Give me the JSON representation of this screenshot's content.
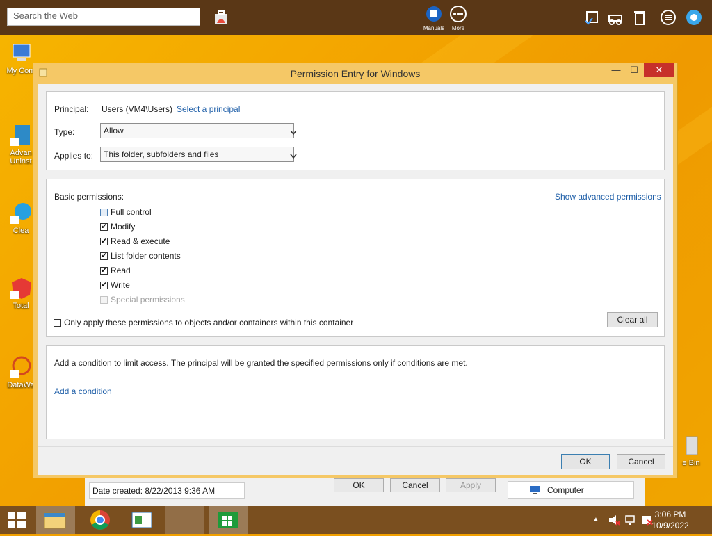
{
  "topbar": {
    "search_placeholder": "Search the Web",
    "manuals_label": "Manuals",
    "more_label": "More"
  },
  "desktop_icons": [
    {
      "label": "My Com"
    },
    {
      "label": "Advan Uninst"
    },
    {
      "label": "Clea"
    },
    {
      "label": "Total"
    },
    {
      "label": "DataWa"
    },
    {
      "label": "e Bin"
    }
  ],
  "dialog": {
    "title": "Permission Entry for Windows",
    "principal_label": "Principal:",
    "principal_value": "Users (VM4\\Users)",
    "select_principal_link": "Select a principal",
    "type_label": "Type:",
    "type_value": "Allow",
    "applies_label": "Applies to:",
    "applies_value": "This folder, subfolders and files",
    "basic_permissions_label": "Basic permissions:",
    "show_advanced_link": "Show advanced permissions",
    "permissions": [
      {
        "label": "Full control",
        "checked": false
      },
      {
        "label": "Modify",
        "checked": true
      },
      {
        "label": "Read & execute",
        "checked": true
      },
      {
        "label": "List folder contents",
        "checked": true
      },
      {
        "label": "Read",
        "checked": true
      },
      {
        "label": "Write",
        "checked": true
      },
      {
        "label": "Special permissions",
        "checked": false,
        "disabled": true
      }
    ],
    "only_apply_label": "Only apply these permissions to objects and/or containers within this container",
    "clear_all_label": "Clear all",
    "condition_text": "Add a condition to limit access. The principal will be granted the specified permissions only if conditions are met.",
    "add_condition_link": "Add a condition",
    "ok_label": "OK",
    "cancel_label": "Cancel"
  },
  "behind_window": {
    "date_created": "Date created: 8/22/2013 9:36 AM",
    "ok_label": "OK",
    "cancel_label": "Cancel",
    "apply_label": "Apply",
    "computer_label": "Computer"
  },
  "taskbar": {
    "time": "3:06 PM",
    "date": "10/9/2022"
  },
  "colors": {
    "accent_link": "#1f5fa8",
    "close_button": "#c7302a",
    "dialog_frame": "#f5c866",
    "topbar": "#5a3716",
    "taskbar": "#7a4f1f"
  }
}
